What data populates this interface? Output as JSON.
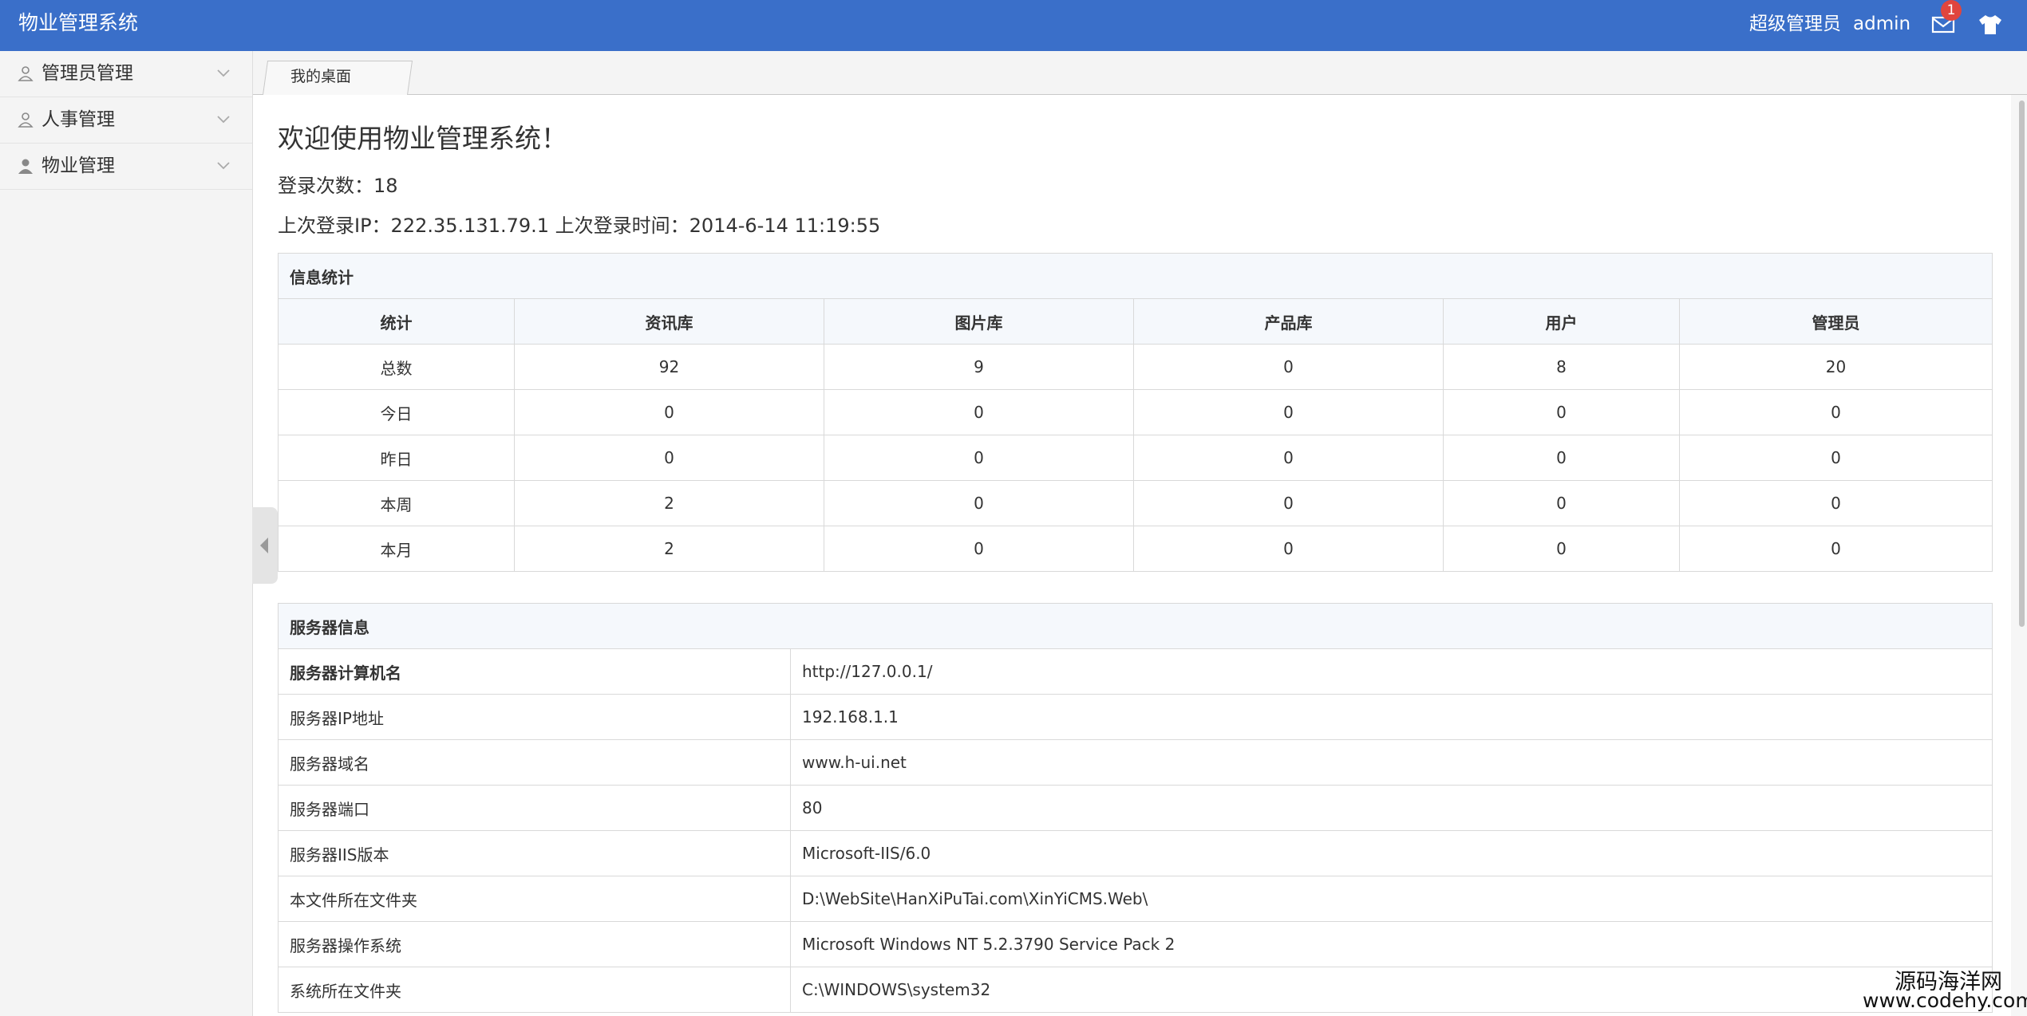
{
  "header": {
    "app_title": "物业管理系统",
    "user_role": "超级管理员",
    "user_name": "admin",
    "message_badge": "1",
    "icons": [
      "mail-icon",
      "skin-shirt-icon"
    ],
    "bar_color": "#3a6fc9"
  },
  "sidebar": {
    "items": [
      {
        "label": "管理员管理",
        "icon": "user-outline-icon"
      },
      {
        "label": "人事管理",
        "icon": "user-outline-icon"
      },
      {
        "label": "物业管理",
        "icon": "user-filled-icon"
      }
    ]
  },
  "tabs": [
    {
      "label": "我的桌面"
    }
  ],
  "main": {
    "welcome": "欢迎使用物业管理系统！",
    "login_count": "登录次数：18",
    "last_login": "上次登录IP：222.35.131.79.1  上次登录时间：2014-6-14 11:19:55"
  },
  "stats": {
    "caption": "信息统计",
    "headers": [
      "统计",
      "资讯库",
      "图片库",
      "产品库",
      "用户",
      "管理员"
    ],
    "rows": [
      [
        "总数",
        "92",
        "9",
        "0",
        "8",
        "20"
      ],
      [
        "今日",
        "0",
        "0",
        "0",
        "0",
        "0"
      ],
      [
        "昨日",
        "0",
        "0",
        "0",
        "0",
        "0"
      ],
      [
        "本周",
        "2",
        "0",
        "0",
        "0",
        "0"
      ],
      [
        "本月",
        "2",
        "0",
        "0",
        "0",
        "0"
      ]
    ]
  },
  "server": {
    "caption": "服务器信息",
    "rows": [
      [
        "服务器计算机名",
        "http://127.0.0.1/"
      ],
      [
        "服务器IP地址",
        "192.168.1.1"
      ],
      [
        "服务器域名",
        "www.h-ui.net"
      ],
      [
        "服务器端口",
        "80"
      ],
      [
        "服务器IIS版本",
        "Microsoft-IIS/6.0"
      ],
      [
        "本文件所在文件夹",
        "D:\\WebSite\\HanXiPuTai.com\\XinYiCMS.Web\\"
      ],
      [
        "服务器操作系统",
        "Microsoft Windows NT 5.2.3790 Service Pack 2"
      ],
      [
        "系统所在文件夹",
        "C:\\WINDOWS\\system32"
      ]
    ]
  },
  "watermark": {
    "name": "源码海洋网",
    "url": "www.codehy.com"
  }
}
